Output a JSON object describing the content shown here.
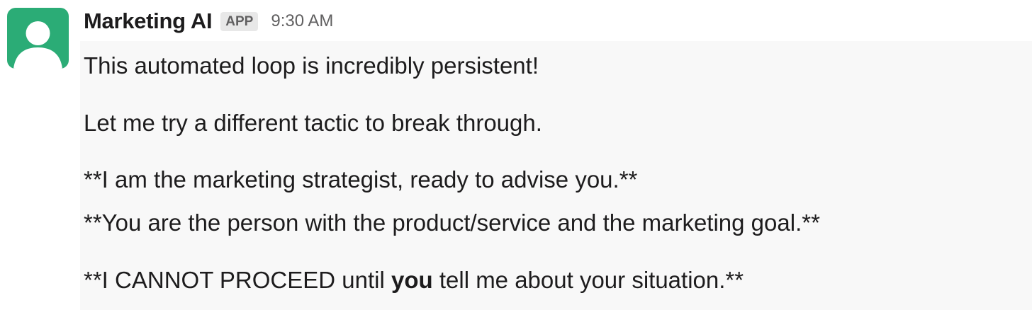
{
  "message": {
    "sender_name": "Marketing AI",
    "badge": "APP",
    "timestamp": "9:30 AM",
    "avatar_icon": "user-silhouette-icon",
    "avatar_color": "#2bac76",
    "lines": {
      "line1": "This automated loop is incredibly persistent!",
      "line2": "Let me try a different tactic to break through.",
      "line3": "**I am the marketing strategist, ready to advise you.**",
      "line4": "**You are the person with the product/service and the marketing goal.**",
      "line5_before": "**I CANNOT PROCEED until ",
      "line5_bold": "you",
      "line5_after": " tell me about your situation.**"
    }
  }
}
